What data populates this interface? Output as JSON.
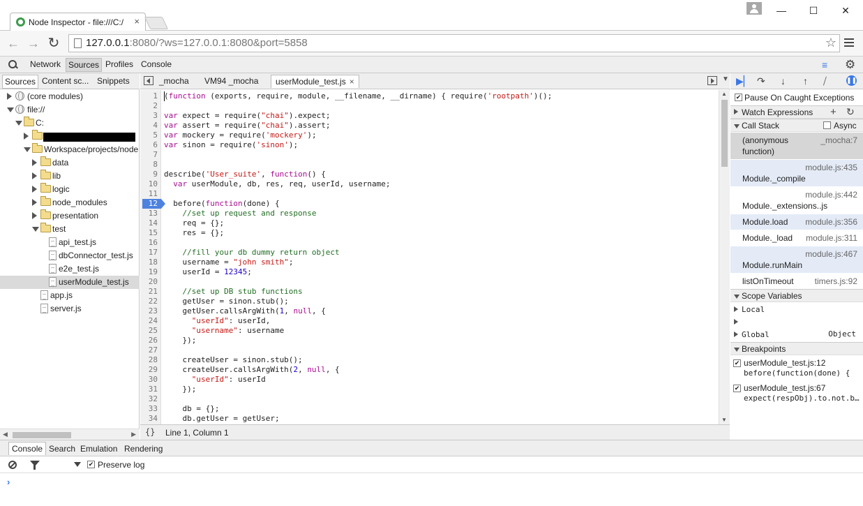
{
  "browser": {
    "tab_title": "Node Inspector - file:///C:/",
    "tab_close": "×",
    "url_host": "127.0.0.1",
    "url_rest": ":8080/?ws=127.0.0.1:8080&port=5858",
    "window_controls": {
      "minimize": "—",
      "maximize": "☐",
      "close": "✕"
    },
    "back_glyph": "←",
    "forward_glyph": "→",
    "reload_glyph": "↻",
    "star_glyph": "☆"
  },
  "devtools": {
    "tabs": [
      "Network",
      "Sources",
      "Profiles",
      "Console"
    ],
    "active_tab": "Sources",
    "drawer_glyph": "≡",
    "gear_glyph": "⚙"
  },
  "navigator": {
    "tabs": [
      "Sources",
      "Content sc...",
      "Snippets"
    ],
    "tree": [
      {
        "label": "(core modules)",
        "indent": 0,
        "icon": "globe-icon",
        "state": "closed"
      },
      {
        "label": "file://",
        "indent": 0,
        "icon": "globe-icon",
        "state": "open"
      },
      {
        "label": "C:",
        "indent": 1,
        "icon": "folder-icon",
        "state": "open"
      },
      {
        "label": "",
        "indent": 2,
        "icon": "folder-icon",
        "state": "closed",
        "redacted": true
      },
      {
        "label": "Workspace/projects/node",
        "indent": 2,
        "icon": "folder-icon",
        "state": "open"
      },
      {
        "label": "data",
        "indent": 3,
        "icon": "folder-icon",
        "state": "closed"
      },
      {
        "label": "lib",
        "indent": 3,
        "icon": "folder-icon",
        "state": "closed"
      },
      {
        "label": "logic",
        "indent": 3,
        "icon": "folder-icon",
        "state": "closed"
      },
      {
        "label": "node_modules",
        "indent": 3,
        "icon": "folder-icon",
        "state": "closed"
      },
      {
        "label": "presentation",
        "indent": 3,
        "icon": "folder-icon",
        "state": "closed"
      },
      {
        "label": "test",
        "indent": 3,
        "icon": "folder-icon",
        "state": "open"
      },
      {
        "label": "api_test.js",
        "indent": 4,
        "icon": "file-icon",
        "state": "leaf"
      },
      {
        "label": "dbConnector_test.js",
        "indent": 4,
        "icon": "file-icon",
        "state": "leaf"
      },
      {
        "label": "e2e_test.js",
        "indent": 4,
        "icon": "file-icon",
        "state": "leaf"
      },
      {
        "label": "userModule_test.js",
        "indent": 4,
        "icon": "file-icon",
        "state": "leaf",
        "selected": true
      },
      {
        "label": "app.js",
        "indent": 3,
        "icon": "file-icon",
        "state": "leaf"
      },
      {
        "label": "server.js",
        "indent": 3,
        "icon": "file-icon",
        "state": "leaf"
      }
    ]
  },
  "editor": {
    "tabs": [
      "_mocha",
      "VM94 _mocha"
    ],
    "active_tab": "userModule_test.js",
    "active_tab_close": "×",
    "breakpoint_line": 12,
    "lines": [
      [
        [
          "(",
          "p"
        ],
        [
          "function",
          "k"
        ],
        [
          " (exports, require, module, __filename, __dirname) { require(",
          "p"
        ],
        [
          "'rootpath'",
          "s"
        ],
        [
          ")();",
          "p"
        ]
      ],
      [],
      [
        [
          "var",
          "k"
        ],
        [
          " expect = require(",
          "p"
        ],
        [
          "\"chai\"",
          "s"
        ],
        [
          ").expect;",
          "p"
        ]
      ],
      [
        [
          "var",
          "k"
        ],
        [
          " assert = require(",
          "p"
        ],
        [
          "\"chai\"",
          "s"
        ],
        [
          ").assert;",
          "p"
        ]
      ],
      [
        [
          "var",
          "k"
        ],
        [
          " mockery = require(",
          "p"
        ],
        [
          "'mockery'",
          "s"
        ],
        [
          ");",
          "p"
        ]
      ],
      [
        [
          "var",
          "k"
        ],
        [
          " sinon = require(",
          "p"
        ],
        [
          "'sinon'",
          "s"
        ],
        [
          ");",
          "p"
        ]
      ],
      [],
      [],
      [
        [
          "describe(",
          "p"
        ],
        [
          "'User_suite'",
          "s"
        ],
        [
          ", ",
          "p"
        ],
        [
          "function",
          "k"
        ],
        [
          "() {",
          "p"
        ]
      ],
      [
        [
          "  ",
          "p"
        ],
        [
          "var",
          "k"
        ],
        [
          " userModule, db, res, req, userId, username;",
          "p"
        ]
      ],
      [],
      [
        [
          "  before(",
          "p"
        ],
        [
          "function",
          "k"
        ],
        [
          "(done) {",
          "p"
        ]
      ],
      [
        [
          "    //set up request and response",
          "c"
        ]
      ],
      [
        [
          "    req = {};",
          "p"
        ]
      ],
      [
        [
          "    res = {};",
          "p"
        ]
      ],
      [],
      [
        [
          "    //fill your db dummy return object",
          "c"
        ]
      ],
      [
        [
          "    username = ",
          "p"
        ],
        [
          "\"john smith\"",
          "s"
        ],
        [
          ";",
          "p"
        ]
      ],
      [
        [
          "    userId = ",
          "p"
        ],
        [
          "12345",
          "n"
        ],
        [
          ";",
          "p"
        ]
      ],
      [],
      [
        [
          "    //set up DB stub functions",
          "c"
        ]
      ],
      [
        [
          "    getUser = sinon.stub();",
          "p"
        ]
      ],
      [
        [
          "    getUser.callsArgWith(",
          "p"
        ],
        [
          "1",
          "n"
        ],
        [
          ", ",
          "p"
        ],
        [
          "null",
          "k"
        ],
        [
          ", {",
          "p"
        ]
      ],
      [
        [
          "      ",
          "p"
        ],
        [
          "\"userId\"",
          "s"
        ],
        [
          ": userId,",
          "p"
        ]
      ],
      [
        [
          "      ",
          "p"
        ],
        [
          "\"username\"",
          "s"
        ],
        [
          ": username",
          "p"
        ]
      ],
      [
        [
          "    });",
          "p"
        ]
      ],
      [],
      [
        [
          "    createUser = sinon.stub();",
          "p"
        ]
      ],
      [
        [
          "    createUser.callsArgWith(",
          "p"
        ],
        [
          "2",
          "n"
        ],
        [
          ", ",
          "p"
        ],
        [
          "null",
          "k"
        ],
        [
          ", {",
          "p"
        ]
      ],
      [
        [
          "      ",
          "p"
        ],
        [
          "\"userId\"",
          "s"
        ],
        [
          ": userId",
          "p"
        ]
      ],
      [
        [
          "    });",
          "p"
        ]
      ],
      [],
      [
        [
          "    db = {};",
          "p"
        ]
      ],
      [
        [
          "    db.getUser = getUser;",
          "p"
        ]
      ]
    ],
    "pretty_print": "{}",
    "cursor_position": "Line 1, Column 1"
  },
  "debugger": {
    "pause_on_caught": "Pause On Caught Exceptions",
    "watch_expressions": "Watch Expressions",
    "call_stack": "Call Stack",
    "async": "Async",
    "stack": [
      {
        "fn": "(anonymous function)",
        "fn1": "(anonymous",
        "fn2": "function)",
        "loc": "_mocha:7",
        "style": "sel",
        "two_line": true
      },
      {
        "fn": "Module._compile",
        "loc": "module.js:435",
        "style": "hl",
        "split": true
      },
      {
        "fn": "Module._extensions..js",
        "loc": "module.js:442",
        "style": "",
        "split": true
      },
      {
        "fn": "Module.load",
        "loc": "module.js:356",
        "style": "hl",
        "split": false
      },
      {
        "fn": "Module._load",
        "loc": "module.js:311",
        "style": "",
        "split": false
      },
      {
        "fn": "Module.runMain",
        "loc": "module.js:467",
        "style": "hl",
        "split": true
      },
      {
        "fn": "listOnTimeout",
        "loc": "timers.js:92",
        "style": "",
        "split": false
      }
    ],
    "scope_variables": "Scope Variables",
    "scope": [
      {
        "name": "Local",
        "value": ""
      },
      {
        "name": "",
        "value": ""
      },
      {
        "name": "Global",
        "value": "Object"
      }
    ],
    "breakpoints_title": "Breakpoints",
    "breakpoints": [
      {
        "file": "userModule_test.js:12",
        "src": "before(function(done) {"
      },
      {
        "file": "userModule_test.js:67",
        "src": "expect(respObj).to.not.b..."
      }
    ]
  },
  "drawer": {
    "tabs": [
      "Console",
      "Search",
      "Emulation",
      "Rendering"
    ],
    "preserve_log": "Preserve log",
    "prompt": "›"
  },
  "colors": {
    "accent": "#3b78e7",
    "breakpoint": "#4e82df",
    "keyword": "#aa0d91",
    "string": "#c41a16",
    "comment": "#236e25",
    "number": "#1c00cf"
  }
}
